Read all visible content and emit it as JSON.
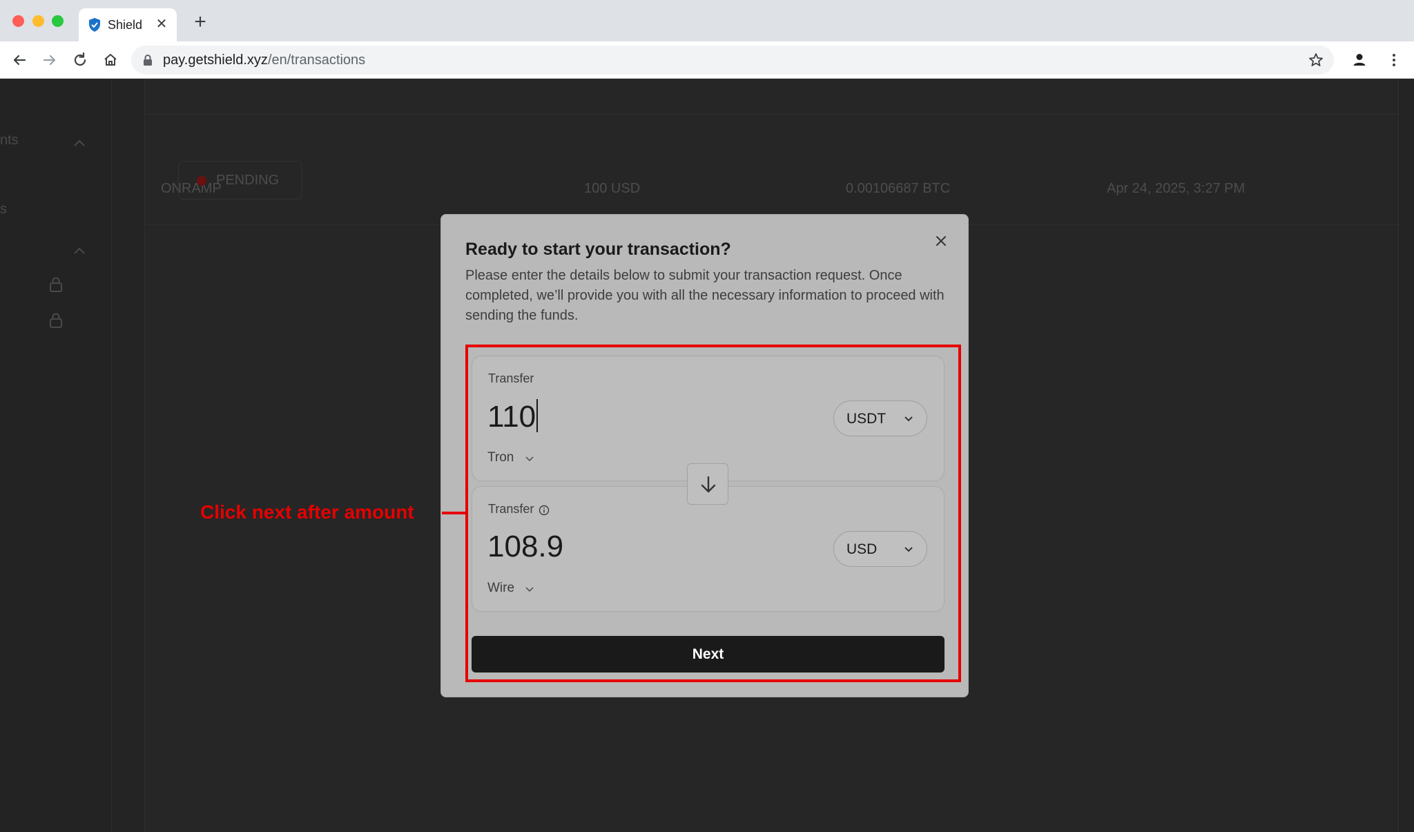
{
  "browser": {
    "tab_title": "Shield",
    "url_host": "pay.getshield.xyz",
    "url_path": "/en/transactions"
  },
  "background_page": {
    "sidebar": {
      "item_1": "nts",
      "item_2": "s"
    },
    "transaction_row": {
      "type": "ONRAMP",
      "status": "PENDING",
      "amount": "100 USD",
      "crypto_amount": "0.00106687 BTC",
      "date": "Apr 24, 2025, 3:27 PM"
    }
  },
  "modal": {
    "title": "Ready to start your transaction?",
    "description": "Please enter the details below to submit your transaction request. Once completed, we’ll provide you with all the necessary information to proceed with sending the funds.",
    "send": {
      "label": "Transfer",
      "amount": "110",
      "currency": "USDT",
      "network": "Tron"
    },
    "receive": {
      "label": "Transfer",
      "amount": "108.9",
      "currency": "USD",
      "network": "Wire"
    },
    "next_label": "Next"
  },
  "annotation": {
    "text": "Click next after amount",
    "color": "#e60000"
  }
}
